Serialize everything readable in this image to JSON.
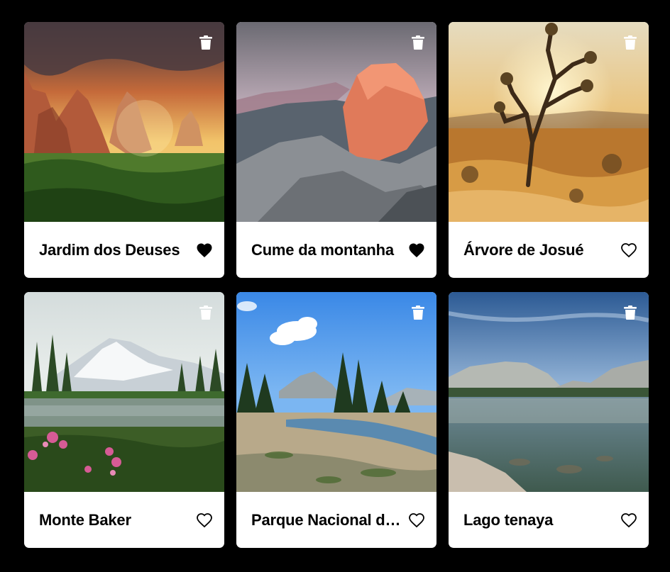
{
  "gallery": {
    "cards": [
      {
        "title": "Jardim dos Deuses",
        "liked": true,
        "image_subject": "red rock spires at sunset"
      },
      {
        "title": "Cume da montanha",
        "liked": true,
        "image_subject": "granite dome peak at sunset"
      },
      {
        "title": "Árvore de Josué",
        "liked": false,
        "image_subject": "joshua tree in desert at sunset"
      },
      {
        "title": "Monte Baker",
        "liked": false,
        "image_subject": "snowy mountain with lake and pink flowers"
      },
      {
        "title": "Parque Nacional de Yosemite",
        "liked": false,
        "image_subject": "meadow with creek and pine trees"
      },
      {
        "title": "Lago tenaya",
        "liked": false,
        "image_subject": "alpine lake with granite mountains"
      }
    ]
  },
  "icons": {
    "delete": "trash-icon",
    "like_filled": "heart-filled-icon",
    "like_outline": "heart-outline-icon"
  },
  "colors": {
    "background": "#000000",
    "card": "#ffffff",
    "text": "#000000",
    "icon_on_photo": "#ffffff"
  }
}
